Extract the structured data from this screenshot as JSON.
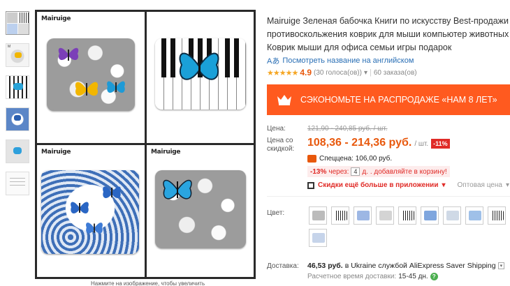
{
  "gallery": {
    "brand": "Mairuige",
    "caption": "Нажмите на изображение, чтобы увеличить"
  },
  "product": {
    "title": "Mairuige Зеленая бабочка Книги по искусству Best-продажи противоскольжения коврик для мыши компьютер животных Коврик мыши для офиса семьи игры подарок",
    "translate_link": "Посмотреть название на английском",
    "translate_icon": "translate-icon",
    "stars": "★★★★★",
    "rating": "4.9",
    "votes": "(30 голоса(ов))",
    "votes_caret": "▾",
    "orders": "60 заказа(ов)",
    "banner": "СЭКОНОМЬТЕ НА РАСПРОДАЖЕ «НАМ 8 ЛЕТ»"
  },
  "pricing": {
    "price_label": "Цена:",
    "old_price": "121,90 - 240,85 руб. / шт.",
    "discount_label": "Цена со скидкой:",
    "price": "108,36 - 214,36 руб.",
    "unit": "/ шт.",
    "discount": "-11%",
    "special": "Спеццена: 106,00 руб.",
    "coupon_pct": "-13%",
    "coupon_via": "через:",
    "coupon_qty": "4",
    "coupon_rest": "д. . добавляйте в корзину!",
    "app_text": "Скидки ещё больше в приложении",
    "app_caret": "▾",
    "wholesale": "Оптовая цена",
    "wholesale_caret": "▾"
  },
  "options": {
    "color_label": "Цвет:",
    "swatch_count": 10
  },
  "shipping": {
    "label": "Доставка:",
    "price": "46,53 руб.",
    "text": "в Ukraine службой AliExpress Saver Shipping",
    "dropdown": "▾",
    "time_label": "Расчетное время доставки:",
    "time_value": "15-45 дн.",
    "help": "?"
  },
  "colors": {
    "accent": "#ff5a1f",
    "price": "#e8580c",
    "link": "#2a6fb5",
    "sale_red": "#e02b27"
  }
}
